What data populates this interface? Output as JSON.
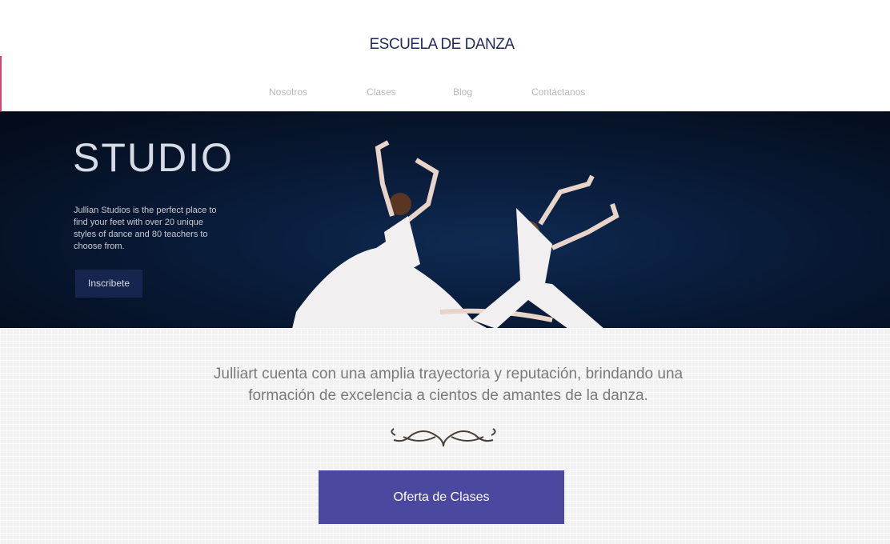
{
  "header": {
    "brand": "ESCUELA DE DANZA"
  },
  "nav": {
    "items": [
      {
        "label": "Nosotros"
      },
      {
        "label": "Clases"
      },
      {
        "label": "Blog"
      },
      {
        "label": "Contáctanos"
      }
    ]
  },
  "hero": {
    "title": "STUDIO",
    "text": "Jullian Studios is the perfect place to find your feet with over 20 unique styles of dance and 80 teachers to choose from.",
    "button": "Inscribete"
  },
  "main": {
    "tagline": "Julliart cuenta con una amplia trayectoria y reputación, brindando una formación de excelencia a cientos de amantes de la danza.",
    "cta": "Oferta de Clases"
  },
  "colors": {
    "brand": "#1f2a55",
    "hero_bg": "#081a36",
    "cta": "#4b48a0"
  }
}
